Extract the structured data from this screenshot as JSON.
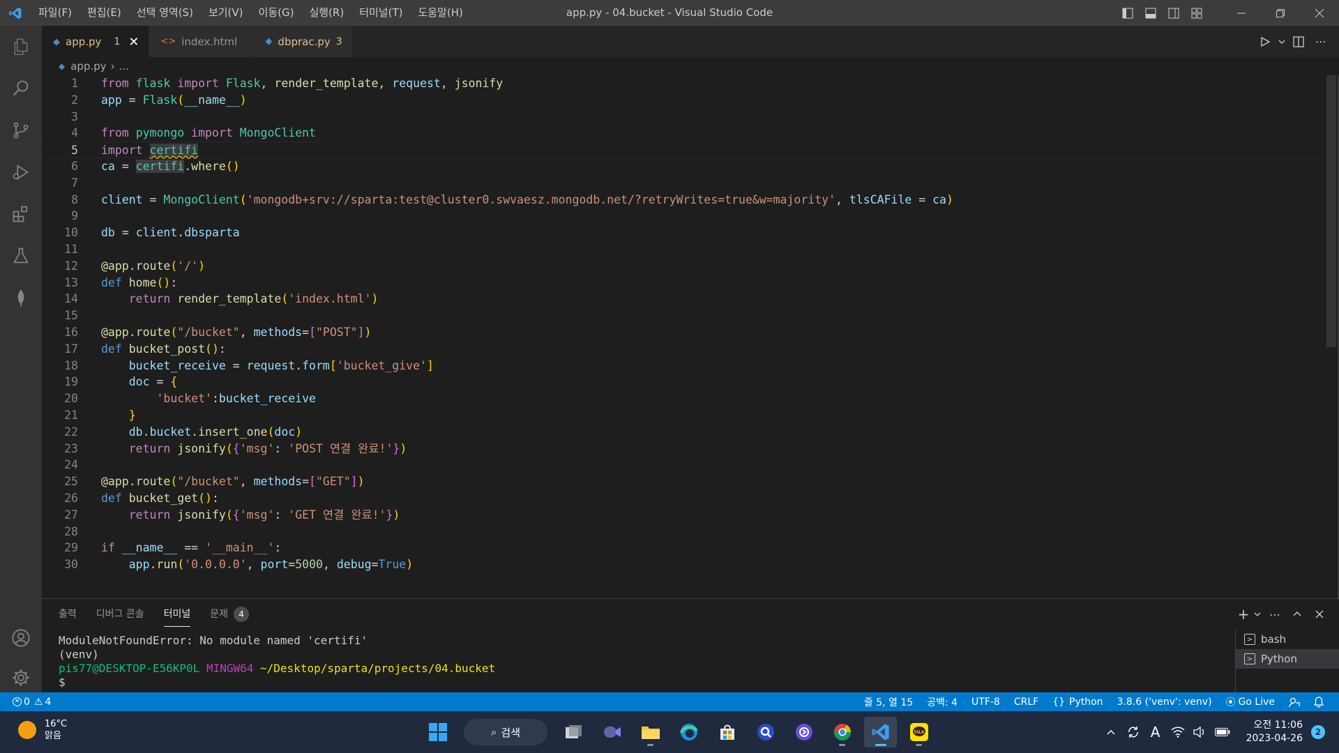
{
  "window": {
    "title": "app.py - 04.bucket - Visual Studio Code"
  },
  "menu": [
    "파일(F)",
    "편집(E)",
    "선택 영역(S)",
    "보기(V)",
    "이동(G)",
    "실행(R)",
    "터미널(T)",
    "도움말(H)"
  ],
  "tabs": [
    {
      "label": "app.py",
      "badge": "1",
      "active": true
    },
    {
      "label": "index.html",
      "badge": "",
      "active": false
    },
    {
      "label": "dbprac.py",
      "badge": "3",
      "active": false
    }
  ],
  "breadcrumb": {
    "file": "app.py",
    "rest": "..."
  },
  "editor": {
    "line_numbers": [
      "1",
      "2",
      "3",
      "4",
      "5",
      "6",
      "7",
      "8",
      "9",
      "10",
      "11",
      "12",
      "13",
      "14",
      "15",
      "16",
      "17",
      "18",
      "19",
      "20",
      "21",
      "22",
      "23",
      "24",
      "25",
      "26",
      "27",
      "28",
      "29",
      "30"
    ],
    "current_line": 5,
    "lines": [
      "from flask import Flask, render_template, request, jsonify",
      "app = Flask(__name__)",
      "",
      "from pymongo import MongoClient",
      "import certifi",
      "ca = certifi.where()",
      "",
      "client = MongoClient('mongodb+srv://sparta:test@cluster0.swvaesz.mongodb.net/?retryWrites=true&w=majority', tlsCAFile = ca)",
      "",
      "db = client.dbsparta",
      "",
      "@app.route('/')",
      "def home():",
      "    return render_template('index.html')",
      "",
      "@app.route(\"/bucket\", methods=[\"POST\"])",
      "def bucket_post():",
      "    bucket_receive = request.form['bucket_give']",
      "    doc = {",
      "        'bucket':bucket_receive",
      "    }",
      "    db.bucket.insert_one(doc)",
      "    return jsonify({'msg': 'POST 연결 완료!'})",
      "",
      "@app.route(\"/bucket\", methods=[\"GET\"])",
      "def bucket_get():",
      "    return jsonify({'msg': 'GET 연결 완료!'})",
      "",
      "if __name__ == '__main__':",
      "    app.run('0.0.0.0', port=5000, debug=True)"
    ]
  },
  "panel": {
    "tabs": [
      "출력",
      "디버그 콘솔",
      "터미널",
      "문제"
    ],
    "active_tab": "터미널",
    "problems_count": "4",
    "terminal_lines": [
      "ModuleNotFoundError: No module named 'certifi'",
      "(venv)"
    ],
    "prompt_user": "pis77@DESKTOP-E56KP0L",
    "prompt_env": "MINGW64",
    "prompt_path": "~/Desktop/sparta/projects/04.bucket",
    "prompt_symbol": "$",
    "terminals": [
      "bash",
      "Python"
    ]
  },
  "statusbar": {
    "errors": "0",
    "warnings": "4",
    "position": "줄 5, 열 15",
    "indent": "공백: 4",
    "encoding": "UTF-8",
    "eol": "CRLF",
    "language": "Python",
    "interpreter": "3.8.6 ('venv': venv)",
    "golive": "Go Live"
  },
  "taskbar": {
    "weather_temp": "16°C",
    "weather_desc": "맑음",
    "search_label": "검색",
    "time": "오전 11:06",
    "date": "2023-04-26",
    "notifications": "2",
    "input_indicator": "A"
  },
  "colors": {
    "accent": "#007acc",
    "titlebar": "#3c3c3c",
    "editor_bg": "#1e1e1e",
    "taskbar": "#1f2a3f"
  }
}
